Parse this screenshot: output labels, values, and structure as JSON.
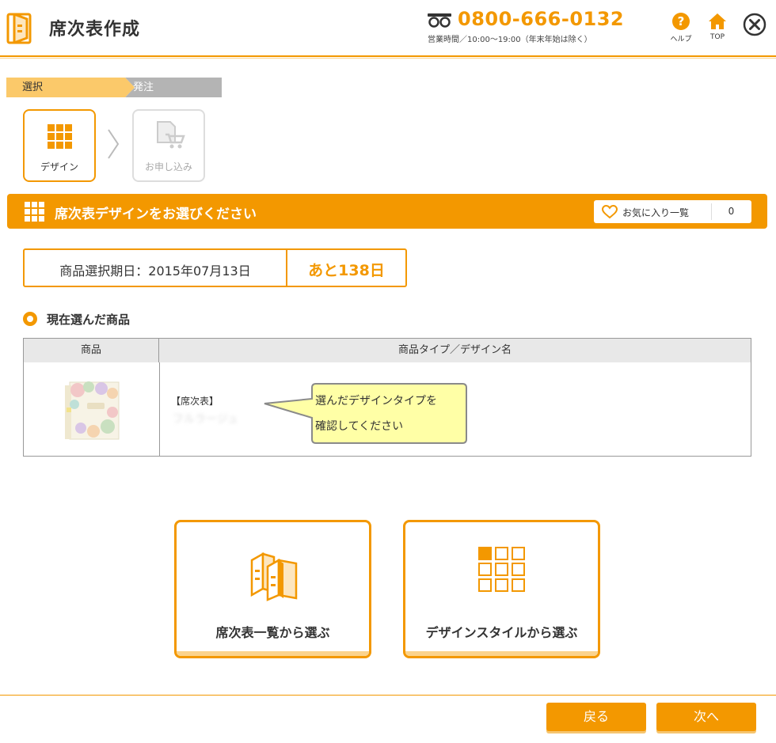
{
  "header": {
    "title": "席次表作成",
    "phone": "0800-666-0132",
    "hours": "営業時間／10:00〜19:00（年末年始は除く）",
    "help_label": "ヘルプ",
    "top_label": "TOP",
    "help_glyph": "?"
  },
  "stepbar": {
    "step1": "選択",
    "step2": "発注"
  },
  "steps": {
    "design_label": "デザイン",
    "apply_label": "お申し込み"
  },
  "section": {
    "title": "席次表デザインをお選びください",
    "favorites_label": "お気に入り一覧",
    "favorites_count": "0"
  },
  "deadline": {
    "text": "商品選択期日：2015年07月13日",
    "remaining": "あと138日"
  },
  "current": {
    "title": "現在選んだ商品",
    "col_product": "商品",
    "col_type": "商品タイプ／デザイン名",
    "product_type": "【席次表】",
    "product_name": "フルラージュ",
    "callout_line1": "選んだデザインタイプを",
    "callout_line2": "確認してください"
  },
  "choices": {
    "list_label": "席次表一覧から選ぶ",
    "style_label": "デザインスタイルから選ぶ"
  },
  "footer": {
    "back_label": "戻る",
    "next_label": "次へ"
  },
  "colors": {
    "accent": "#f39800",
    "accent_light": "#fbd38c",
    "step_active": "#fbc96a",
    "step_inactive": "#b4b4b4"
  }
}
